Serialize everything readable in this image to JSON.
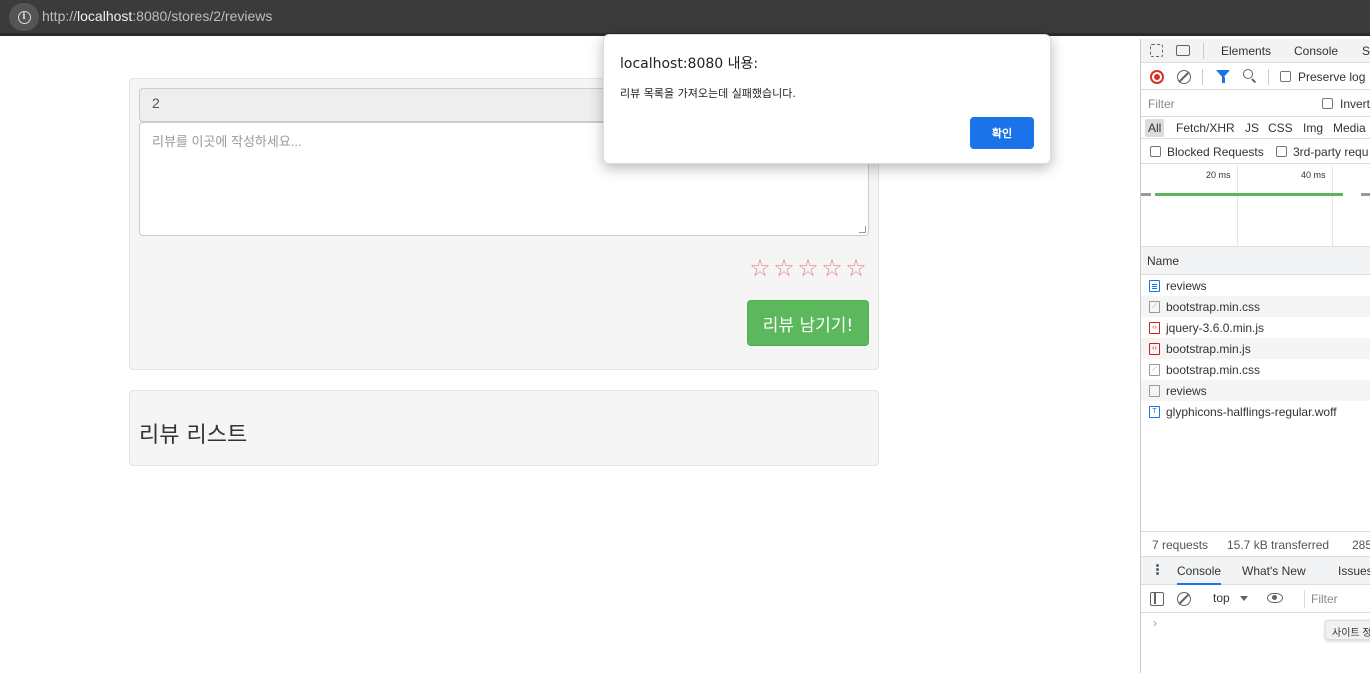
{
  "browser": {
    "url_prefix": "http://",
    "url_host": "localhost",
    "url_rest": ":8080/stores/2/reviews"
  },
  "form": {
    "store_id_value": "2",
    "review_placeholder": "리뷰를 이곳에 작성하세요...",
    "star_glyph": "☆",
    "stars_total": 5,
    "submit_label": "리뷰 남기기!"
  },
  "review_list": {
    "title": "리뷰 리스트"
  },
  "alert": {
    "title": "localhost:8080 내용:",
    "message": "리뷰 목록을 가져오는데 실패했습니다.",
    "ok_label": "확인"
  },
  "devtools": {
    "tabs": [
      "Elements",
      "Console",
      "S"
    ],
    "preserve_log": "Preserve log",
    "filter_placeholder": "Filter",
    "invert": "Invert",
    "types": [
      "All",
      "Fetch/XHR",
      "JS",
      "CSS",
      "Img",
      "Media"
    ],
    "blocked_requests": "Blocked Requests",
    "third_party": "3rd-party requ",
    "timeline_ticks": [
      "20 ms",
      "40 ms"
    ],
    "name_header": "Name",
    "requests": [
      {
        "name": "reviews",
        "icon": "document-icon"
      },
      {
        "name": "bootstrap.min.css",
        "icon": "stylesheet-icon"
      },
      {
        "name": "jquery-3.6.0.min.js",
        "icon": "script-icon"
      },
      {
        "name": "bootstrap.min.js",
        "icon": "script-icon"
      },
      {
        "name": "bootstrap.min.css",
        "icon": "stylesheet-icon"
      },
      {
        "name": "reviews",
        "icon": "blank-document-icon"
      },
      {
        "name": "glyphicons-halflings-regular.woff",
        "icon": "font-icon"
      }
    ],
    "status": {
      "requests": "7 requests",
      "transferred": "15.7 kB transferred",
      "resources": "285"
    },
    "drawer_tabs": [
      "Console",
      "What's New",
      "Issues"
    ],
    "console_context": "top",
    "console_filter": "Filter",
    "console_prompt": "›",
    "tooltip": "사이트 정"
  },
  "colors": {
    "success": "#5cb85c",
    "alert_button": "#1a73e8",
    "record": "#d93025"
  }
}
